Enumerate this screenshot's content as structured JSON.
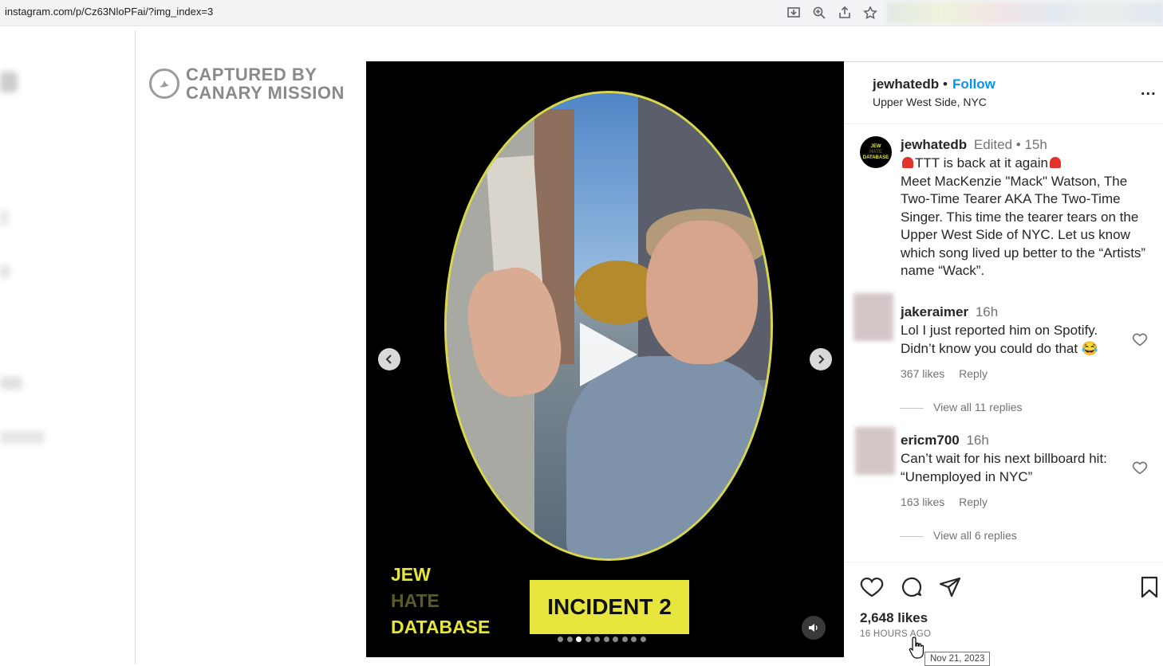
{
  "browser": {
    "url": "instagram.com/p/Cz63NloPFai/?img_index=3",
    "icons": [
      "install-icon",
      "zoom-icon",
      "share-icon",
      "bookmark-star-icon"
    ]
  },
  "watermark": {
    "line1": "CAPTURED BY",
    "line2": "CANARY MISSION"
  },
  "media": {
    "logo_line1": "JEW",
    "logo_line2": "HATE",
    "logo_line3": "DATABASE",
    "badge": "INCIDENT 2",
    "carousel_count": 10,
    "carousel_active_index": 2
  },
  "post": {
    "username": "jewhatedb",
    "separator": "•",
    "follow_label": "Follow",
    "location": "Upper West Side, NYC",
    "more_label": "...",
    "avatar_lines": [
      "JEW",
      "HATE",
      "DATABASE"
    ],
    "caption_user": "jewhatedb",
    "caption_meta": "Edited • 15h",
    "caption_line1": "TTT is back at it again",
    "caption_body": "Meet MacKenzie \"Mack\" Watson, The Two-Time Tearer AKA The Two-Time Singer. This time the tearer tears on the Upper West Side of NYC. Let us know which song lived up better to the “Artists” name “Wack”."
  },
  "comments": [
    {
      "user": "jakeraimer",
      "time": "16h",
      "text": "Lol I just reported him on Spotify. Didn’t know you could do that 😂",
      "likes": "367 likes",
      "reply_label": "Reply",
      "view_replies": "View all 11 replies"
    },
    {
      "user": "ericm700",
      "time": "16h",
      "text": "Can’t wait for his next billboard hit: “Unemployed in NYC”",
      "likes": "163 likes",
      "reply_label": "Reply",
      "view_replies": "View all 6 replies"
    }
  ],
  "footer": {
    "likes": "2,648 likes",
    "time_ago": "16 HOURS AGO",
    "tooltip": "Nov 21, 2023"
  }
}
